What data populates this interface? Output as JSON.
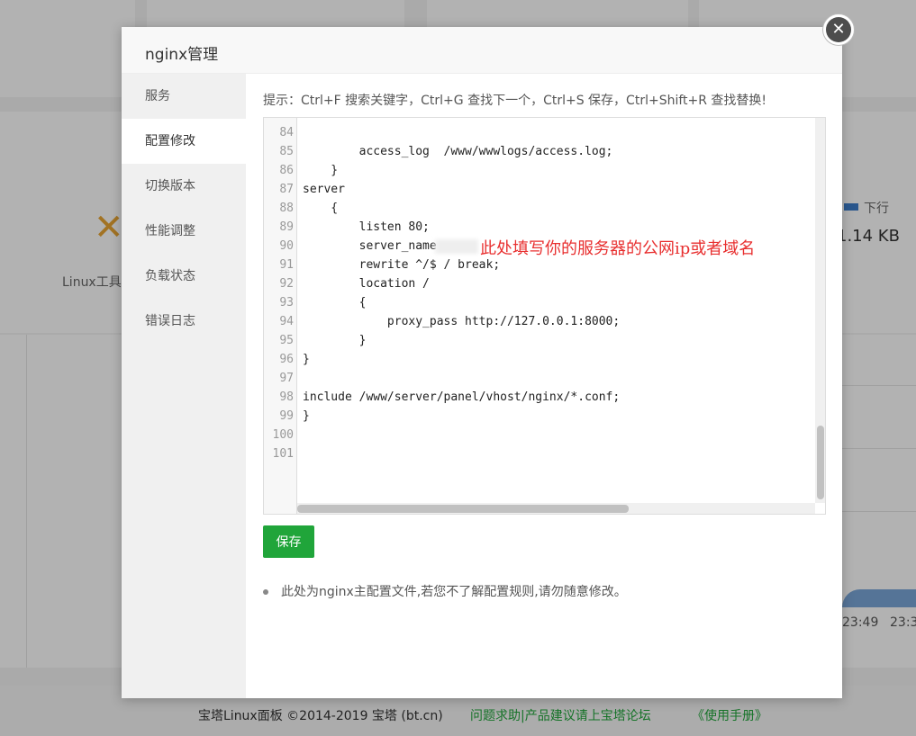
{
  "dialog": {
    "title": "nginx管理",
    "close_icon": "close-icon"
  },
  "sidebar": {
    "items": [
      {
        "label": "服务"
      },
      {
        "label": "配置修改",
        "active": true
      },
      {
        "label": "切换版本"
      },
      {
        "label": "性能调整"
      },
      {
        "label": "负载状态"
      },
      {
        "label": "错误日志"
      }
    ]
  },
  "hint": "提示：Ctrl+F 搜索关键字，Ctrl+G 查找下一个，Ctrl+S 保存，Ctrl+Shift+R 查找替换!",
  "editor": {
    "lines": [
      {
        "n": "84",
        "text": ""
      },
      {
        "n": "85",
        "text": "        access_log  /www/wwwlogs/access.log;"
      },
      {
        "n": "86",
        "text": "    }"
      },
      {
        "n": "87",
        "text": "server"
      },
      {
        "n": "88",
        "text": "    {"
      },
      {
        "n": "89",
        "text": "        listen 80;"
      },
      {
        "n": "90",
        "text": "        server_name"
      },
      {
        "n": "91",
        "text": "        rewrite ^/$ / break;"
      },
      {
        "n": "92",
        "text": "        location /"
      },
      {
        "n": "93",
        "text": "        {"
      },
      {
        "n": "94",
        "text": "            proxy_pass http://127.0.0.1:8000;"
      },
      {
        "n": "95",
        "text": "        }"
      },
      {
        "n": "96",
        "text": "}"
      },
      {
        "n": "97",
        "text": ""
      },
      {
        "n": "98",
        "text": "include /www/server/panel/vhost/nginx/*.conf;"
      },
      {
        "n": "99",
        "text": "}"
      },
      {
        "n": "100",
        "text": ""
      },
      {
        "n": "101",
        "text": ""
      }
    ],
    "annotation": "此处填写你的服务器的公网ip或者域名"
  },
  "save_label": "保存",
  "note": "此处为nginx主配置文件,若您不了解配置规则,请勿随意修改。",
  "background": {
    "tool_label": "Linux工具",
    "legend_label": "下行",
    "speed": "1.14 KB",
    "tick1": "23:49",
    "tick2": "23:3",
    "legend_color": "#3d7dca"
  },
  "footer": {
    "copyright": "宝塔Linux面板 ©2014-2019 宝塔 (bt.cn)",
    "link_forum": "问题求助|产品建议请上宝塔论坛",
    "link_manual": "《使用手册》"
  },
  "colors": {
    "accent": "#20a53a",
    "annotation": "#e82f2f"
  }
}
